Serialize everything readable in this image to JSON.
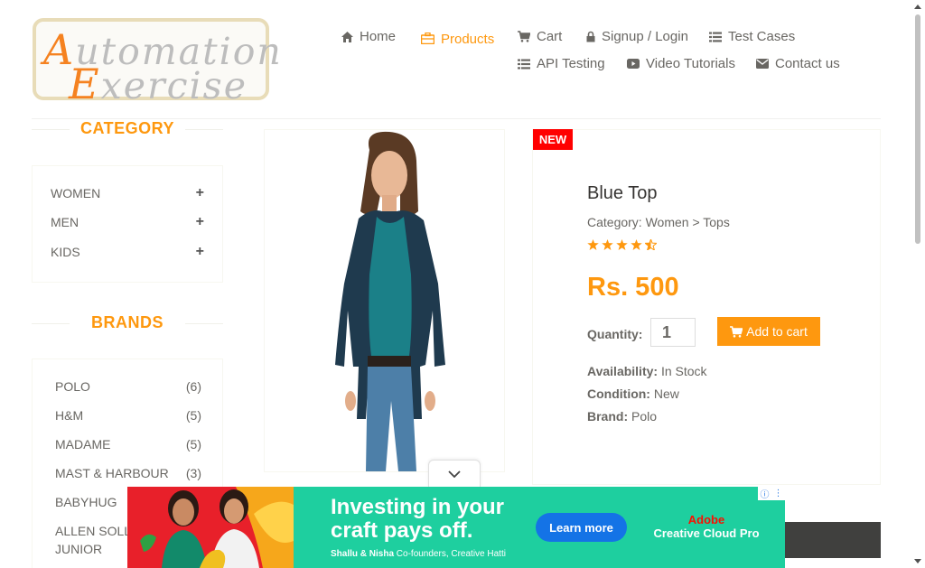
{
  "header": {
    "logo": {
      "line1": "Automation",
      "line2": "Exercise"
    },
    "nav": [
      {
        "label": "Home",
        "icon": "home-icon",
        "active": false
      },
      {
        "label": "Products",
        "icon": "briefcase-icon",
        "active": true
      },
      {
        "label": "Cart",
        "icon": "cart-icon",
        "active": false
      },
      {
        "label": "Signup / Login",
        "icon": "lock-icon",
        "active": false
      },
      {
        "label": "Test Cases",
        "icon": "list-icon",
        "active": false
      },
      {
        "label": "API Testing",
        "icon": "list-icon",
        "active": false
      },
      {
        "label": "Video Tutorials",
        "icon": "youtube-icon",
        "active": false
      },
      {
        "label": "Contact us",
        "icon": "envelope-icon",
        "active": false
      }
    ]
  },
  "sidebar": {
    "category_title": "CATEGORY",
    "categories": [
      {
        "label": "WOMEN",
        "toggle": "+"
      },
      {
        "label": "MEN",
        "toggle": "+"
      },
      {
        "label": "KIDS",
        "toggle": "+"
      }
    ],
    "brands_title": "BRANDS",
    "brands": [
      {
        "label": "POLO",
        "count": "(6)"
      },
      {
        "label": "H&M",
        "count": "(5)"
      },
      {
        "label": "MADAME",
        "count": "(5)"
      },
      {
        "label": "MAST & HARBOUR",
        "count": "(3)"
      },
      {
        "label": "BABYHUG",
        "count": ""
      },
      {
        "label": "ALLEN SOLLY",
        "count": ""
      },
      {
        "label": "JUNIOR",
        "count": ""
      }
    ]
  },
  "product": {
    "badge": "NEW",
    "name": "Blue Top",
    "category": "Category: Women > Tops",
    "rating_stars": 4.5,
    "price": "Rs. 500",
    "quantity_label": "Quantity:",
    "quantity_value": "1",
    "add_to_cart": "Add to cart",
    "availability_label": "Availability:",
    "availability": "In Stock",
    "condition_label": "Condition:",
    "condition": "New",
    "brand_label": "Brand:",
    "brand": "Polo"
  },
  "ad": {
    "headline1": "Investing in your",
    "headline2": "craft pays off.",
    "byline_names": "Shallu & Nisha",
    "byline_role": "Co-founders, Creative Hatti",
    "cta": "Learn more",
    "brand1": "Adobe",
    "brand2": "Creative Cloud Pro"
  },
  "colors": {
    "accent": "#FE980F",
    "badge": "#FF0000",
    "ad_bg": "#1ECF9F",
    "ad_cta": "#1473E6"
  }
}
